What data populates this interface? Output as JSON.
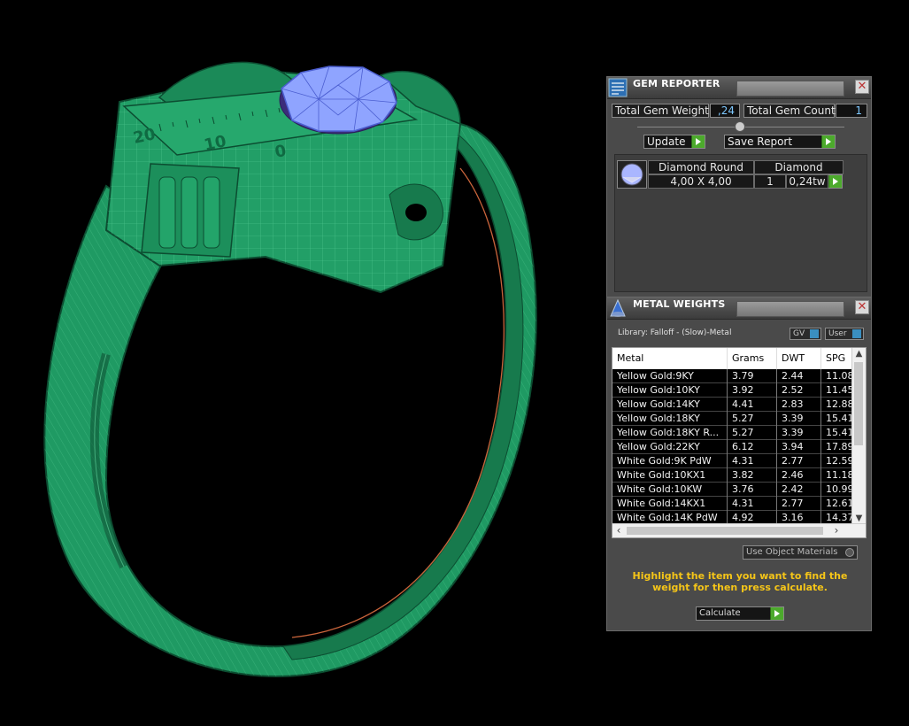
{
  "gem_reporter": {
    "title": "GEM REPORTER",
    "total_gem_weight_label": "Total Gem Weight",
    "total_gem_weight_value": ",24",
    "total_gem_count_label": "Total Gem Count",
    "total_gem_count_value": "1",
    "update_label": "Update",
    "save_report_label": "Save Report",
    "gem_row": {
      "name": "Diamond Round",
      "type": "Diamond",
      "size": "4,00 X 4,00",
      "count": "1",
      "weight": "0,24tw"
    }
  },
  "metal_weights": {
    "title": "METAL WEIGHTS",
    "library": "Library: Falloff - (Slow)-Metal",
    "gv_label": "GV",
    "user_label": "User",
    "columns": [
      "Metal",
      "Grams",
      "DWT",
      "SPG"
    ],
    "rows": [
      {
        "metal": "Yellow Gold:9KY",
        "grams": "3.79",
        "dwt": "2.44",
        "spg": "11.08"
      },
      {
        "metal": "Yellow Gold:10KY",
        "grams": "3.92",
        "dwt": "2.52",
        "spg": "11.45"
      },
      {
        "metal": "Yellow Gold:14KY",
        "grams": "4.41",
        "dwt": "2.83",
        "spg": "12.88"
      },
      {
        "metal": "Yellow Gold:18KY",
        "grams": "5.27",
        "dwt": "3.39",
        "spg": "15.41"
      },
      {
        "metal": "Yellow Gold:18KY R...",
        "grams": "5.27",
        "dwt": "3.39",
        "spg": "15.41"
      },
      {
        "metal": "Yellow Gold:22KY",
        "grams": "6.12",
        "dwt": "3.94",
        "spg": "17.89"
      },
      {
        "metal": "White Gold:9K PdW",
        "grams": "4.31",
        "dwt": "2.77",
        "spg": "12.59"
      },
      {
        "metal": "White Gold:10KX1",
        "grams": "3.82",
        "dwt": "2.46",
        "spg": "11.18"
      },
      {
        "metal": "White Gold:10KW",
        "grams": "3.76",
        "dwt": "2.42",
        "spg": "10.99"
      },
      {
        "metal": "White Gold:14KX1",
        "grams": "4.31",
        "dwt": "2.77",
        "spg": "12.61"
      },
      {
        "metal": "White Gold:14K PdW",
        "grams": "4.92",
        "dwt": "3.16",
        "spg": "14.37"
      }
    ],
    "use_object_materials_label": "Use Object Materials",
    "hint": "Highlight the item you want to find the weight for then press calculate.",
    "calculate_label": "Calculate"
  },
  "viewport": {
    "ruler_labels": [
      "20",
      "10",
      "0"
    ],
    "colors": {
      "ring": "#1f9a63",
      "wire": "#5fd39b",
      "gem": "#8fa4ff"
    }
  }
}
